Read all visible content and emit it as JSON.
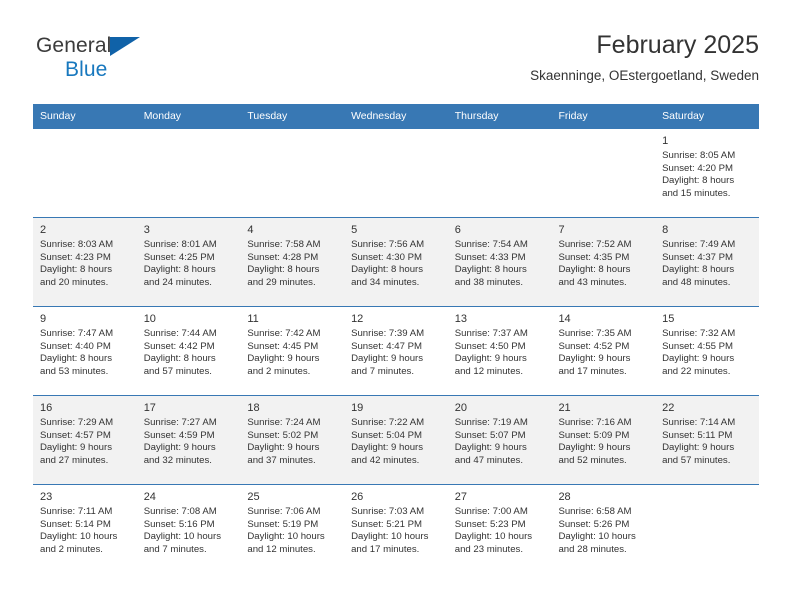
{
  "brand": {
    "name_part1": "General",
    "name_part2": "Blue",
    "accent_color": "#1878be",
    "triangle_color": "#1062a8"
  },
  "header": {
    "title": "February 2025",
    "subtitle": "Skaenninge, OEstergoetland, Sweden"
  },
  "theme": {
    "header_row_bg": "#3878b4",
    "alt_row_bg": "#f2f2f2",
    "text_color": "#333333"
  },
  "weekday_headers": [
    "Sunday",
    "Monday",
    "Tuesday",
    "Wednesday",
    "Thursday",
    "Friday",
    "Saturday"
  ],
  "weeks": [
    [
      {
        "day": "",
        "sunrise": "",
        "sunset": "",
        "daylight_line1": "",
        "daylight_line2": ""
      },
      {
        "day": "",
        "sunrise": "",
        "sunset": "",
        "daylight_line1": "",
        "daylight_line2": ""
      },
      {
        "day": "",
        "sunrise": "",
        "sunset": "",
        "daylight_line1": "",
        "daylight_line2": ""
      },
      {
        "day": "",
        "sunrise": "",
        "sunset": "",
        "daylight_line1": "",
        "daylight_line2": ""
      },
      {
        "day": "",
        "sunrise": "",
        "sunset": "",
        "daylight_line1": "",
        "daylight_line2": ""
      },
      {
        "day": "",
        "sunrise": "",
        "sunset": "",
        "daylight_line1": "",
        "daylight_line2": ""
      },
      {
        "day": "1",
        "sunrise": "Sunrise: 8:05 AM",
        "sunset": "Sunset: 4:20 PM",
        "daylight_line1": "Daylight: 8 hours",
        "daylight_line2": "and 15 minutes."
      }
    ],
    [
      {
        "day": "2",
        "sunrise": "Sunrise: 8:03 AM",
        "sunset": "Sunset: 4:23 PM",
        "daylight_line1": "Daylight: 8 hours",
        "daylight_line2": "and 20 minutes."
      },
      {
        "day": "3",
        "sunrise": "Sunrise: 8:01 AM",
        "sunset": "Sunset: 4:25 PM",
        "daylight_line1": "Daylight: 8 hours",
        "daylight_line2": "and 24 minutes."
      },
      {
        "day": "4",
        "sunrise": "Sunrise: 7:58 AM",
        "sunset": "Sunset: 4:28 PM",
        "daylight_line1": "Daylight: 8 hours",
        "daylight_line2": "and 29 minutes."
      },
      {
        "day": "5",
        "sunrise": "Sunrise: 7:56 AM",
        "sunset": "Sunset: 4:30 PM",
        "daylight_line1": "Daylight: 8 hours",
        "daylight_line2": "and 34 minutes."
      },
      {
        "day": "6",
        "sunrise": "Sunrise: 7:54 AM",
        "sunset": "Sunset: 4:33 PM",
        "daylight_line1": "Daylight: 8 hours",
        "daylight_line2": "and 38 minutes."
      },
      {
        "day": "7",
        "sunrise": "Sunrise: 7:52 AM",
        "sunset": "Sunset: 4:35 PM",
        "daylight_line1": "Daylight: 8 hours",
        "daylight_line2": "and 43 minutes."
      },
      {
        "day": "8",
        "sunrise": "Sunrise: 7:49 AM",
        "sunset": "Sunset: 4:37 PM",
        "daylight_line1": "Daylight: 8 hours",
        "daylight_line2": "and 48 minutes."
      }
    ],
    [
      {
        "day": "9",
        "sunrise": "Sunrise: 7:47 AM",
        "sunset": "Sunset: 4:40 PM",
        "daylight_line1": "Daylight: 8 hours",
        "daylight_line2": "and 53 minutes."
      },
      {
        "day": "10",
        "sunrise": "Sunrise: 7:44 AM",
        "sunset": "Sunset: 4:42 PM",
        "daylight_line1": "Daylight: 8 hours",
        "daylight_line2": "and 57 minutes."
      },
      {
        "day": "11",
        "sunrise": "Sunrise: 7:42 AM",
        "sunset": "Sunset: 4:45 PM",
        "daylight_line1": "Daylight: 9 hours",
        "daylight_line2": "and 2 minutes."
      },
      {
        "day": "12",
        "sunrise": "Sunrise: 7:39 AM",
        "sunset": "Sunset: 4:47 PM",
        "daylight_line1": "Daylight: 9 hours",
        "daylight_line2": "and 7 minutes."
      },
      {
        "day": "13",
        "sunrise": "Sunrise: 7:37 AM",
        "sunset": "Sunset: 4:50 PM",
        "daylight_line1": "Daylight: 9 hours",
        "daylight_line2": "and 12 minutes."
      },
      {
        "day": "14",
        "sunrise": "Sunrise: 7:35 AM",
        "sunset": "Sunset: 4:52 PM",
        "daylight_line1": "Daylight: 9 hours",
        "daylight_line2": "and 17 minutes."
      },
      {
        "day": "15",
        "sunrise": "Sunrise: 7:32 AM",
        "sunset": "Sunset: 4:55 PM",
        "daylight_line1": "Daylight: 9 hours",
        "daylight_line2": "and 22 minutes."
      }
    ],
    [
      {
        "day": "16",
        "sunrise": "Sunrise: 7:29 AM",
        "sunset": "Sunset: 4:57 PM",
        "daylight_line1": "Daylight: 9 hours",
        "daylight_line2": "and 27 minutes."
      },
      {
        "day": "17",
        "sunrise": "Sunrise: 7:27 AM",
        "sunset": "Sunset: 4:59 PM",
        "daylight_line1": "Daylight: 9 hours",
        "daylight_line2": "and 32 minutes."
      },
      {
        "day": "18",
        "sunrise": "Sunrise: 7:24 AM",
        "sunset": "Sunset: 5:02 PM",
        "daylight_line1": "Daylight: 9 hours",
        "daylight_line2": "and 37 minutes."
      },
      {
        "day": "19",
        "sunrise": "Sunrise: 7:22 AM",
        "sunset": "Sunset: 5:04 PM",
        "daylight_line1": "Daylight: 9 hours",
        "daylight_line2": "and 42 minutes."
      },
      {
        "day": "20",
        "sunrise": "Sunrise: 7:19 AM",
        "sunset": "Sunset: 5:07 PM",
        "daylight_line1": "Daylight: 9 hours",
        "daylight_line2": "and 47 minutes."
      },
      {
        "day": "21",
        "sunrise": "Sunrise: 7:16 AM",
        "sunset": "Sunset: 5:09 PM",
        "daylight_line1": "Daylight: 9 hours",
        "daylight_line2": "and 52 minutes."
      },
      {
        "day": "22",
        "sunrise": "Sunrise: 7:14 AM",
        "sunset": "Sunset: 5:11 PM",
        "daylight_line1": "Daylight: 9 hours",
        "daylight_line2": "and 57 minutes."
      }
    ],
    [
      {
        "day": "23",
        "sunrise": "Sunrise: 7:11 AM",
        "sunset": "Sunset: 5:14 PM",
        "daylight_line1": "Daylight: 10 hours",
        "daylight_line2": "and 2 minutes."
      },
      {
        "day": "24",
        "sunrise": "Sunrise: 7:08 AM",
        "sunset": "Sunset: 5:16 PM",
        "daylight_line1": "Daylight: 10 hours",
        "daylight_line2": "and 7 minutes."
      },
      {
        "day": "25",
        "sunrise": "Sunrise: 7:06 AM",
        "sunset": "Sunset: 5:19 PM",
        "daylight_line1": "Daylight: 10 hours",
        "daylight_line2": "and 12 minutes."
      },
      {
        "day": "26",
        "sunrise": "Sunrise: 7:03 AM",
        "sunset": "Sunset: 5:21 PM",
        "daylight_line1": "Daylight: 10 hours",
        "daylight_line2": "and 17 minutes."
      },
      {
        "day": "27",
        "sunrise": "Sunrise: 7:00 AM",
        "sunset": "Sunset: 5:23 PM",
        "daylight_line1": "Daylight: 10 hours",
        "daylight_line2": "and 23 minutes."
      },
      {
        "day": "28",
        "sunrise": "Sunrise: 6:58 AM",
        "sunset": "Sunset: 5:26 PM",
        "daylight_line1": "Daylight: 10 hours",
        "daylight_line2": "and 28 minutes."
      },
      {
        "day": "",
        "sunrise": "",
        "sunset": "",
        "daylight_line1": "",
        "daylight_line2": ""
      }
    ]
  ]
}
